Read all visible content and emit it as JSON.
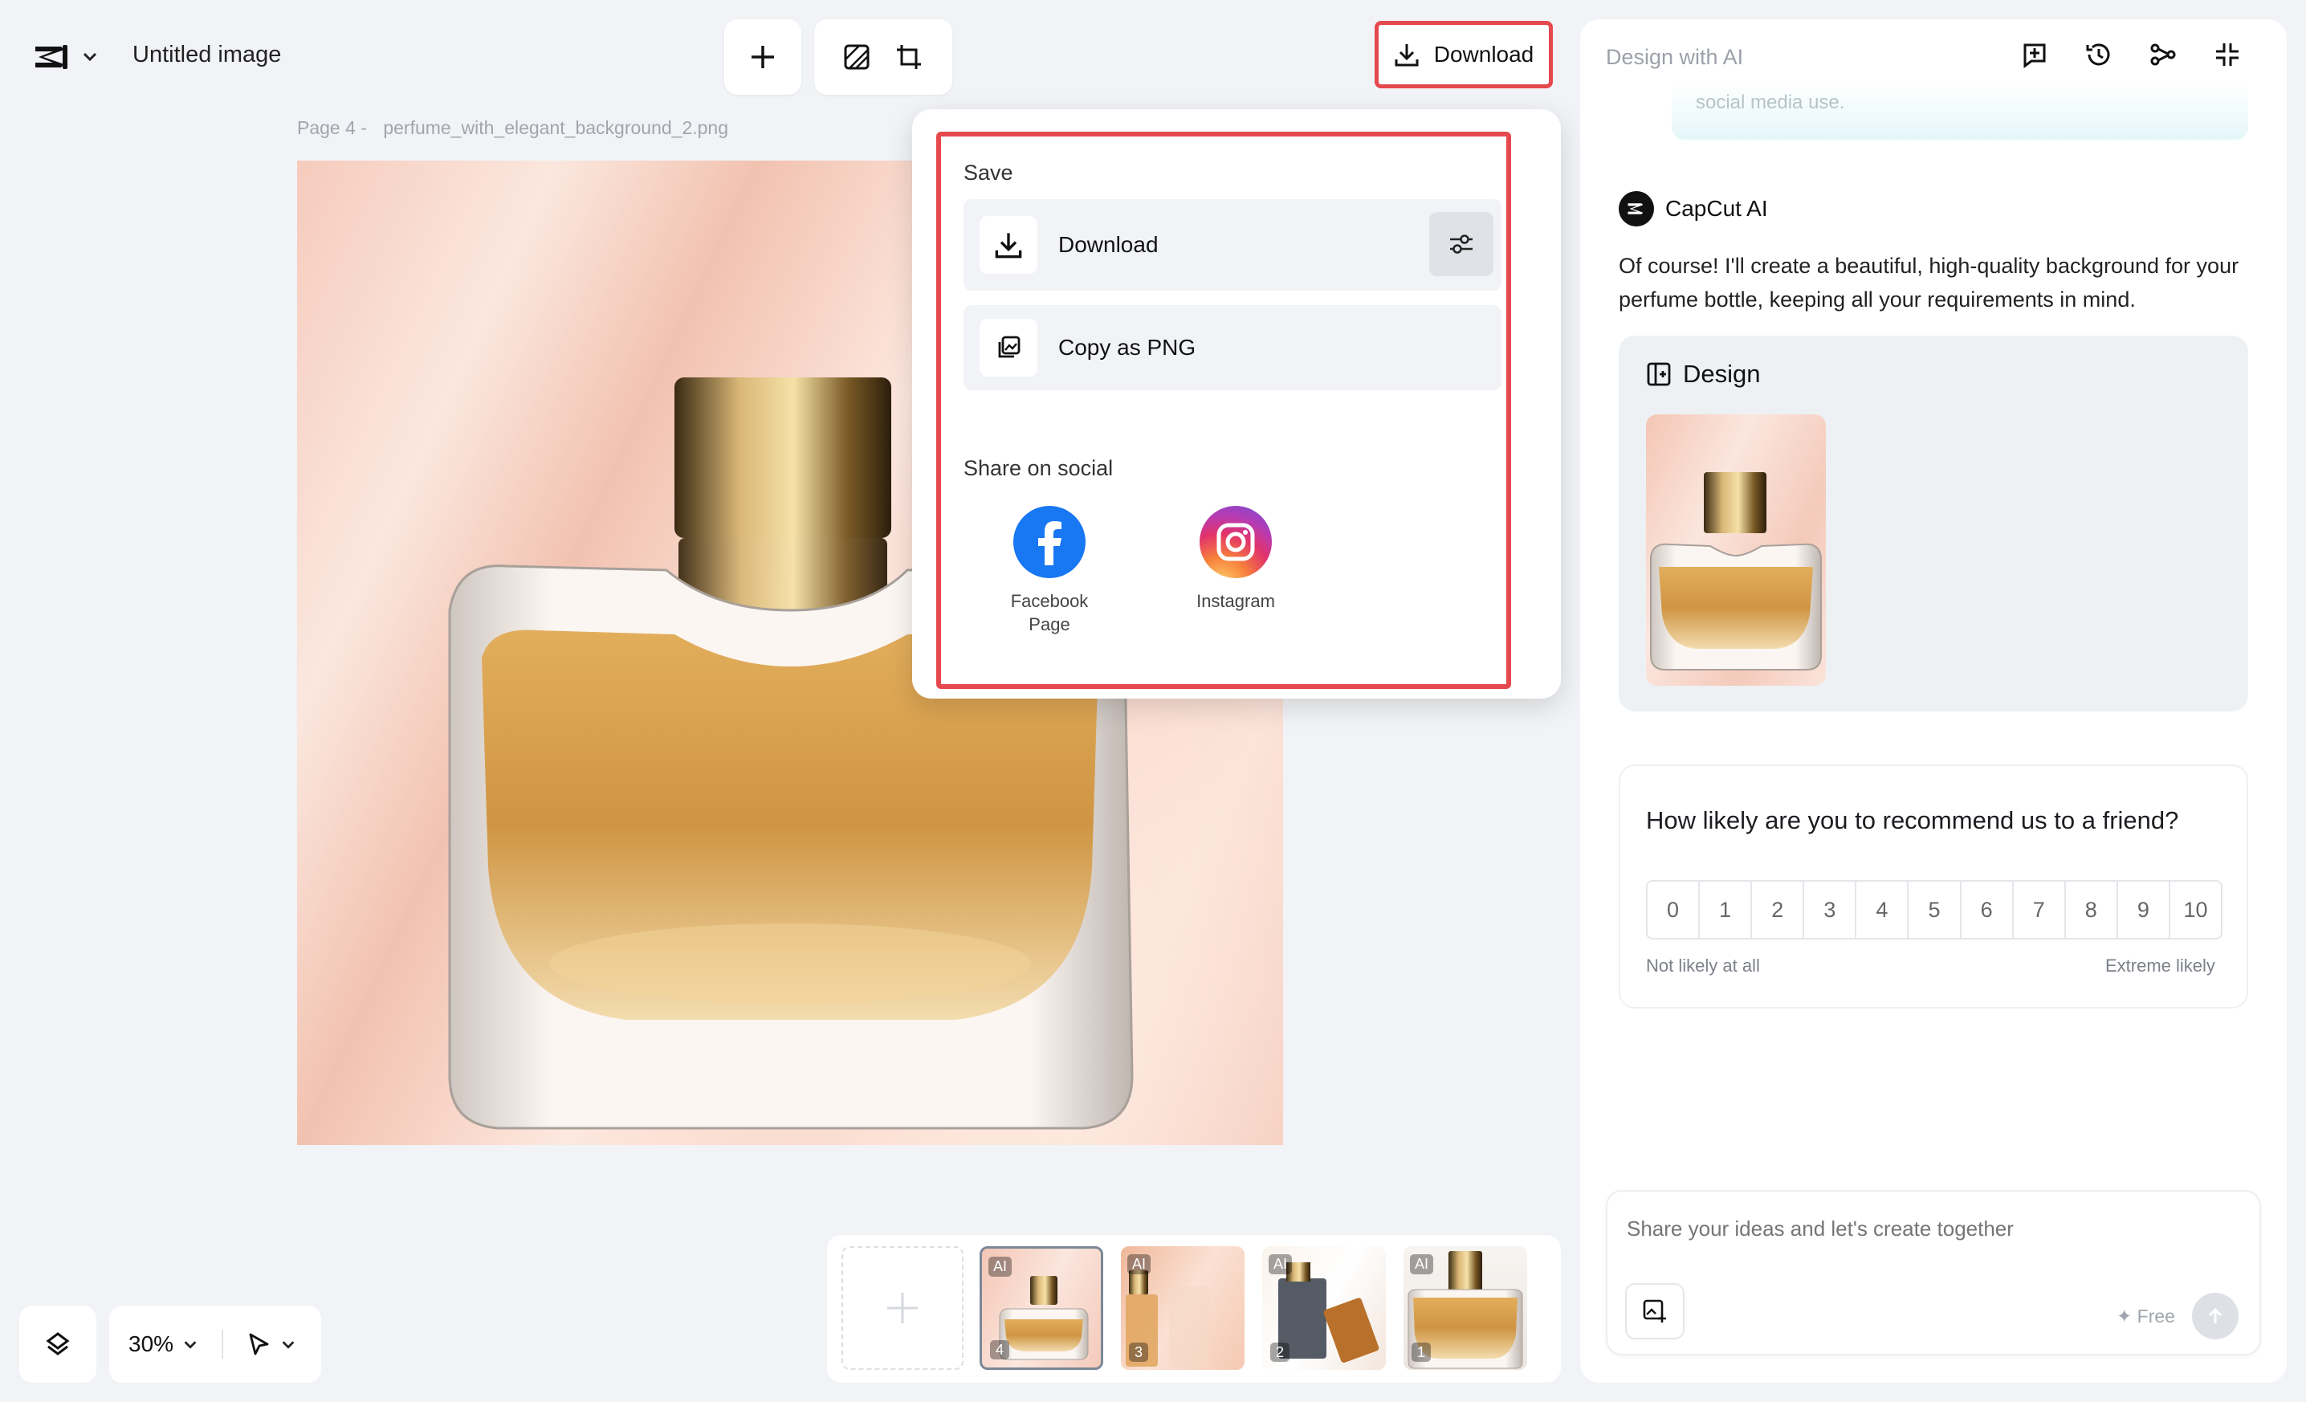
{
  "header": {
    "doc_title": "Untitled image",
    "download_label": "Download"
  },
  "canvas": {
    "page_label": "Page 4 -",
    "file_name": "perfume_with_elegant_background_2.png"
  },
  "popup": {
    "save_label": "Save",
    "download_label": "Download",
    "copy_label": "Copy as PNG",
    "share_label": "Share on social",
    "facebook_label": "Facebook Page",
    "instagram_label": "Instagram"
  },
  "panel": {
    "title": "Design with AI",
    "prev_message": "social media use.",
    "ai_name": "CapCut AI",
    "ai_message": "Of course! I'll create a beautiful, high-quality background for your perfume bottle, keeping all your requirements in mind.",
    "design_label": "Design",
    "survey_question": "How likely are you to recommend us to a friend?",
    "scale": [
      "0",
      "1",
      "2",
      "3",
      "4",
      "5",
      "6",
      "7",
      "8",
      "9",
      "10"
    ],
    "scale_low": "Not likely at all",
    "scale_high": "Extreme likely",
    "composer_placeholder": "Share your ideas and let's create together",
    "free_label": "✦ Free"
  },
  "bottom": {
    "zoom": "30%"
  },
  "pages": [
    {
      "badge": "AI",
      "num": "4"
    },
    {
      "badge": "AI",
      "num": "3"
    },
    {
      "badge": "AI",
      "num": "2"
    },
    {
      "badge": "AI",
      "num": "1"
    }
  ],
  "colors": {
    "accent_red": "#e5484d",
    "facebook": "#1877f2",
    "background": "#f1f3f6"
  }
}
